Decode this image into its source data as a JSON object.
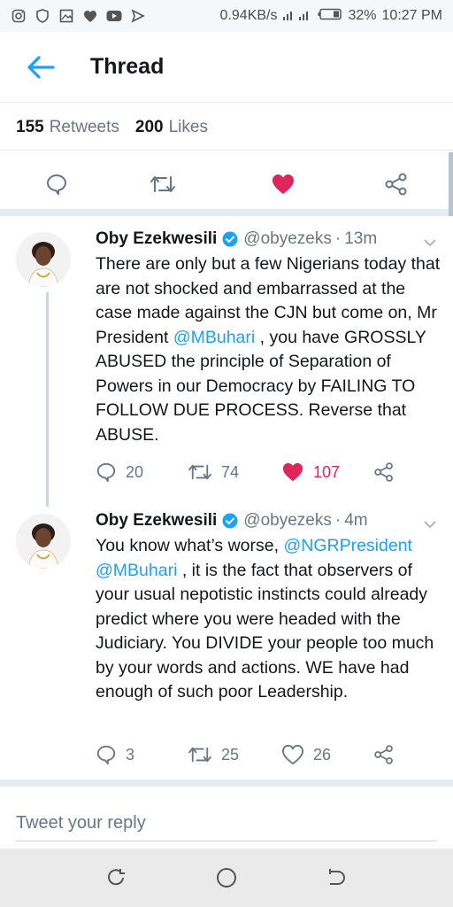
{
  "status_bar": {
    "speed": "0.94KB/s",
    "battery": "32%",
    "time": "10:27 PM"
  },
  "header": {
    "title": "Thread"
  },
  "stats": {
    "retweets_count": "155",
    "retweets_label": "Retweets",
    "likes_count": "200",
    "likes_label": "Likes"
  },
  "colors": {
    "accent": "#1da1f2",
    "like": "#e0245e",
    "muted": "#657786"
  },
  "tweets": [
    {
      "name": "Oby Ezekwesili",
      "handle": "@obyezeks",
      "dot": "·",
      "time": "13m",
      "text_parts": [
        "There are only but a few Nigerians today that are not shocked and embarrassed at the case made against the CJN but come on, Mr President ",
        "@MBuhari",
        " , you have GROSSLY ABUSED the principle of Separation of Powers in our Democracy by FAILING TO FOLLOW DUE PROCESS. Reverse that ABUSE."
      ],
      "replies": "20",
      "retweets": "74",
      "likes": "107",
      "liked": true
    },
    {
      "name": "Oby Ezekwesili",
      "handle": "@obyezeks",
      "dot": "·",
      "time": "4m",
      "text_parts": [
        "You know what’s worse, ",
        "@NGRPresident",
        " ",
        "@MBuhari",
        " , it is the fact that observers of your usual  nepotistic instincts could already predict where you were headed with the Judiciary. You DIVIDE your people too much by your words and actions. WE have had enough of such poor Leadership."
      ],
      "replies": "3",
      "retweets": "25",
      "likes": "26",
      "liked": false
    }
  ],
  "reply": {
    "placeholder": "Tweet your reply"
  }
}
